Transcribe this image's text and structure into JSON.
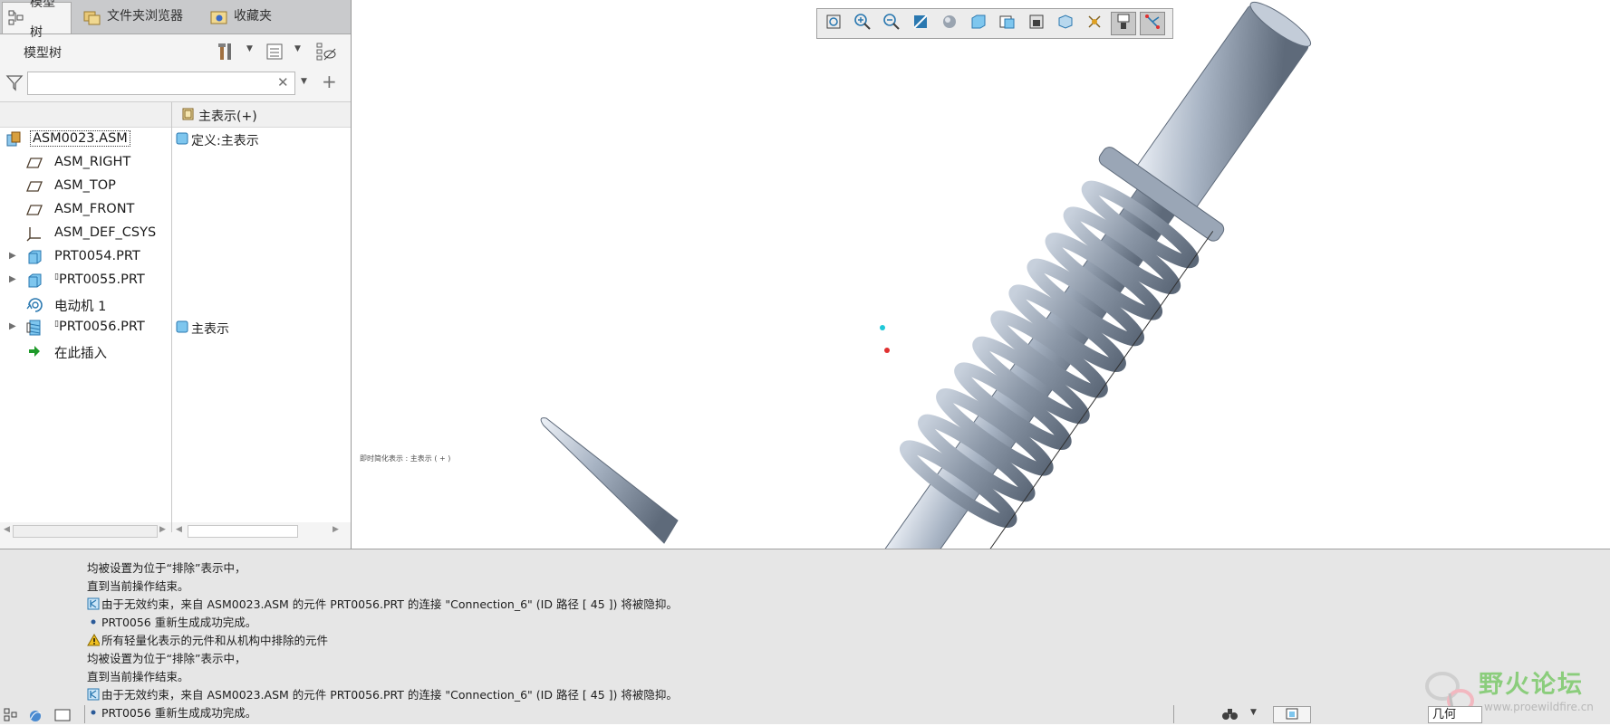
{
  "tabs": [
    {
      "label": "模型树",
      "icon": "model-tree-icon",
      "active": true
    },
    {
      "label": "文件夹浏览器",
      "icon": "folder-browser-icon",
      "active": false
    },
    {
      "label": "收藏夹",
      "icon": "favorites-icon",
      "active": false
    }
  ],
  "tree_header": {
    "title": "模型树"
  },
  "search": {
    "value": "",
    "placeholder": ""
  },
  "tree": {
    "column_header": "主表示(+)",
    "rows": [
      {
        "label": "ASM0023.ASM",
        "col2": "定义:主表示",
        "icon": "assembly-icon"
      },
      {
        "label": "ASM_RIGHT",
        "col2": "",
        "icon": "datum-plane-icon"
      },
      {
        "label": "ASM_TOP",
        "col2": "",
        "icon": "datum-plane-icon"
      },
      {
        "label": "ASM_FRONT",
        "col2": "",
        "icon": "datum-plane-icon"
      },
      {
        "label": "ASM_DEF_CSYS",
        "col2": "",
        "icon": "csys-icon"
      },
      {
        "label": "PRT0054.PRT",
        "col2": "",
        "icon": "part-icon"
      },
      {
        "label": "PRT0055.PRT",
        "col2": "",
        "icon": "part-icon"
      },
      {
        "label": "电动机 1",
        "col2": "",
        "icon": "motor-icon"
      },
      {
        "label": "PRT0056.PRT",
        "col2": "主表示",
        "icon": "spring-part-icon"
      },
      {
        "label": "在此插入",
        "col2": "",
        "icon": "insert-here-icon"
      }
    ]
  },
  "graphics": {
    "rep_note": "即时简化表示 : 主表示 ( + )",
    "toolbar": [
      "refit-icon",
      "zoom-in-icon",
      "zoom-out-icon",
      "repaint-icon",
      "display-style-icon",
      "saved-views-icon",
      "view-manager-icon",
      "perspective-icon",
      "annotation-display-icon",
      "datum-display-icon",
      "spin-center-icon",
      "mechanism-display-icon"
    ]
  },
  "messages": [
    {
      "text": "均被设置为位于“排除”表示中，",
      "icon": ""
    },
    {
      "text": "直到当前操作结束。",
      "icon": ""
    },
    {
      "text": "由于无效约束，来自 ASM0023.ASM 的元件 PRT0056.PRT 的连接 \"Connection_6\" (ID 路径 [ 45 ]) 将被隐抑。",
      "icon": "constraint-icon"
    },
    {
      "text": "PRT0056 重新生成成功完成。",
      "icon": "bullet-icon"
    },
    {
      "text": "所有轻量化表示的元件和从机构中排除的元件",
      "icon": "warning-icon"
    },
    {
      "text": "均被设置为位于“排除”表示中，",
      "icon": ""
    },
    {
      "text": "直到当前操作结束。",
      "icon": ""
    },
    {
      "text": "由于无效约束，来自 ASM0023.ASM 的元件 PRT0056.PRT 的连接 \"Connection_6\" (ID 路径 [ 45 ]) 将被隐抑。",
      "icon": "constraint-icon"
    },
    {
      "text": "PRT0056 重新生成成功完成。",
      "icon": "bullet-icon"
    }
  ],
  "status_bar": {
    "filter_label": "几何"
  },
  "watermark": {
    "title": "野火论坛",
    "url": "www.proewildfire.cn"
  }
}
